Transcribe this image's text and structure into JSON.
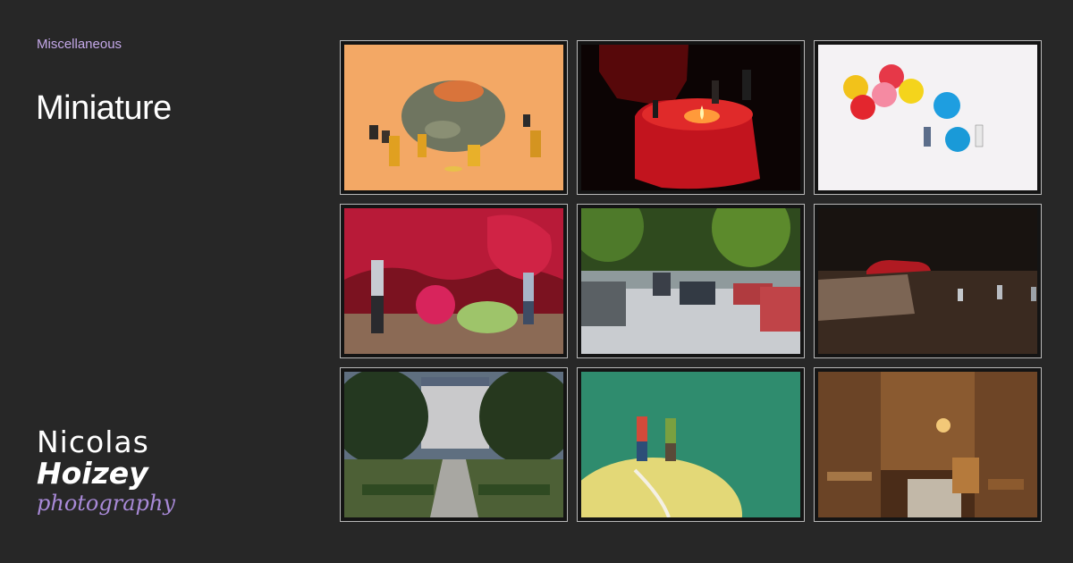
{
  "category": "Miscellaneous",
  "title": "Miniature",
  "logo": {
    "first": "Nicolas",
    "last": "Hoizey",
    "sub": "photography"
  },
  "photos": [
    {
      "subject": "mold-hazmat"
    },
    {
      "subject": "red-candle"
    },
    {
      "subject": "candy-balls"
    },
    {
      "subject": "rose-workers"
    },
    {
      "subject": "street-tiltshift"
    },
    {
      "subject": "red-car-wood"
    },
    {
      "subject": "chateau-garden"
    },
    {
      "subject": "tennis-ball-hikers"
    },
    {
      "subject": "old-shop-interior"
    }
  ]
}
